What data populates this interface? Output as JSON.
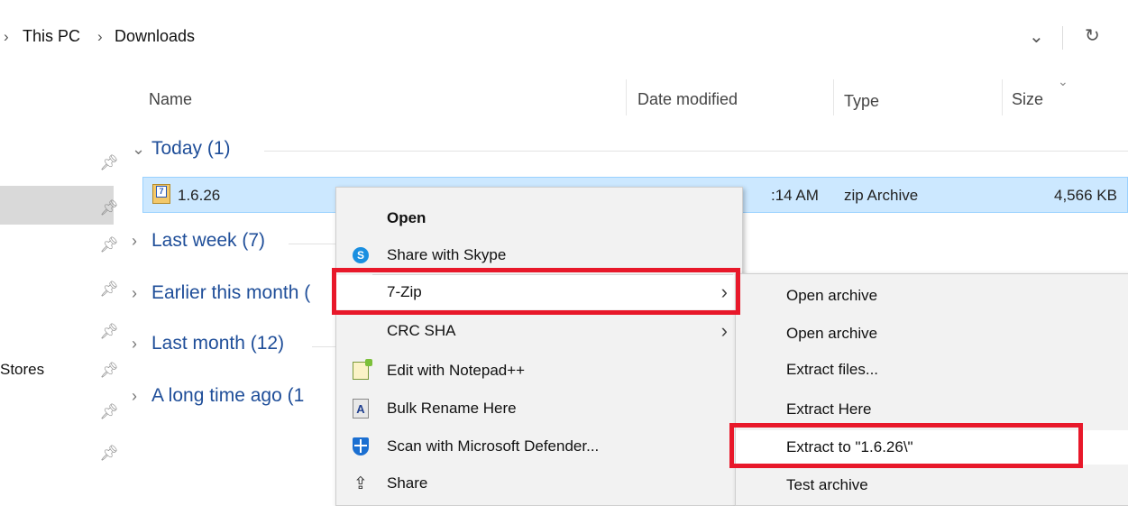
{
  "breadcrumb": {
    "items": [
      "This PC",
      "Downloads"
    ]
  },
  "toolbar": {
    "dropdown_glyph": "⌄",
    "refresh_glyph": "↻"
  },
  "columns": {
    "name": "Name",
    "date_modified": "Date modified",
    "type": "Type",
    "size": "Size"
  },
  "groups": [
    {
      "label": "Today (1)",
      "expanded": true
    },
    {
      "label": "Last week (7)",
      "expanded": false
    },
    {
      "label": "Earlier this month (",
      "expanded": false
    },
    {
      "label": "Last month (12)",
      "expanded": false
    },
    {
      "label": "A long time ago (1",
      "expanded": false
    }
  ],
  "file": {
    "name": "1.6.26",
    "date_modified": ":14 AM",
    "type": "zip Archive",
    "size": "4,566 KB"
  },
  "sidebar": {
    "partial_label": "Stores"
  },
  "context_menu": {
    "items": [
      {
        "label": "Open",
        "bold": true,
        "icon": ""
      },
      {
        "label": "Share with Skype",
        "icon": "skype-icon"
      },
      {
        "label": "7-Zip",
        "icon": "",
        "submenu": true,
        "highlighted": true
      },
      {
        "label": "CRC SHA",
        "icon": "",
        "submenu": true
      },
      {
        "label": "Edit with Notepad++",
        "icon": "notepad-plus-plus-icon"
      },
      {
        "label": "Bulk Rename Here",
        "icon": "bulk-rename-icon"
      },
      {
        "label": "Scan with Microsoft Defender...",
        "icon": "defender-icon"
      },
      {
        "label": "Share",
        "icon": "share-icon"
      }
    ]
  },
  "submenu": {
    "items": [
      {
        "label": "Open archive"
      },
      {
        "label": "Open archive"
      },
      {
        "label": "Extract files..."
      },
      {
        "label": "Extract Here"
      },
      {
        "label": "Extract to \"1.6.26\\\"",
        "highlighted": true
      },
      {
        "label": "Test archive"
      }
    ]
  },
  "colors": {
    "accent": "#1f4e99",
    "selection": "#cce8ff",
    "annotation": "#e8182a"
  }
}
